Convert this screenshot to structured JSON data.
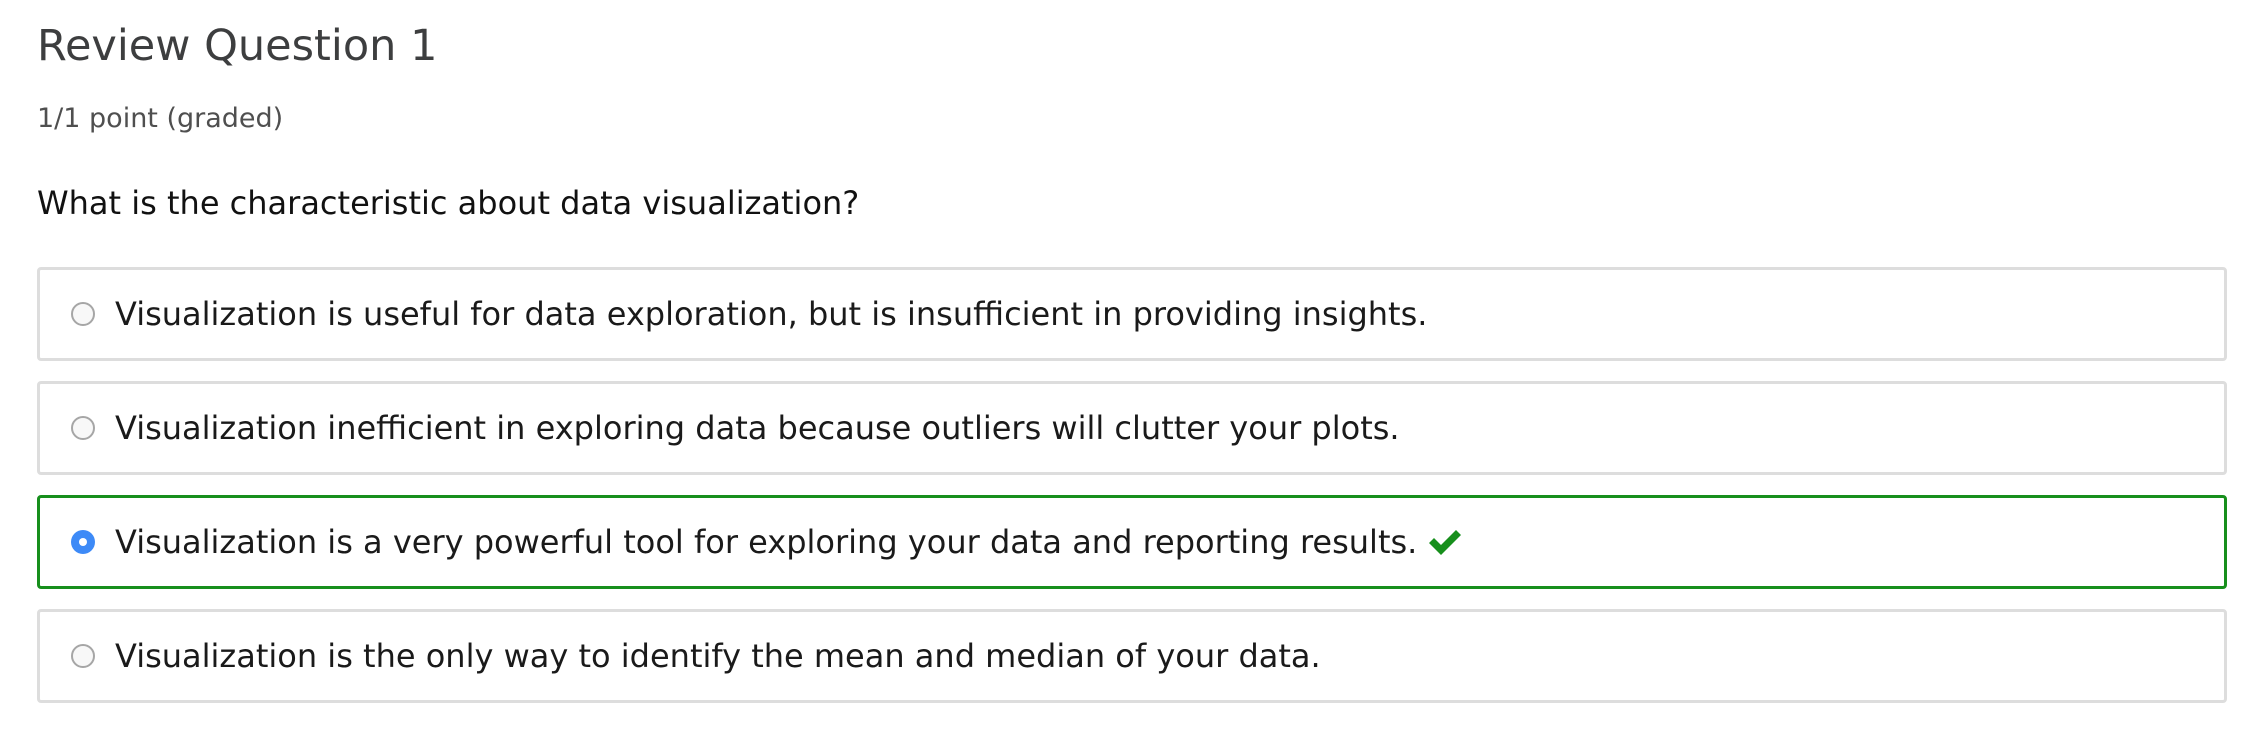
{
  "problem": {
    "title": "Review Question 1",
    "points": "1/1 point (graded)",
    "question": "What is the characteristic about data visualization?",
    "choices": [
      {
        "label": "Visualization is useful for data exploration, but is insufficient in providing insights.",
        "selected": false
      },
      {
        "label": "Visualization inefficient in exploring data because outliers will clutter your plots.",
        "selected": false
      },
      {
        "label": "Visualization is a very powerful tool for exploring your data and reporting results.",
        "selected": true,
        "correct": true
      },
      {
        "label": "Visualization is the only way to identify the mean and median of your data.",
        "selected": false
      }
    ],
    "correct_icon": "checkmark-icon",
    "colors": {
      "correct_border": "#178f1c",
      "correct_icon": "#178f1c",
      "radio_selected": "#3d8af7",
      "choice_border": "#dddddd"
    }
  }
}
